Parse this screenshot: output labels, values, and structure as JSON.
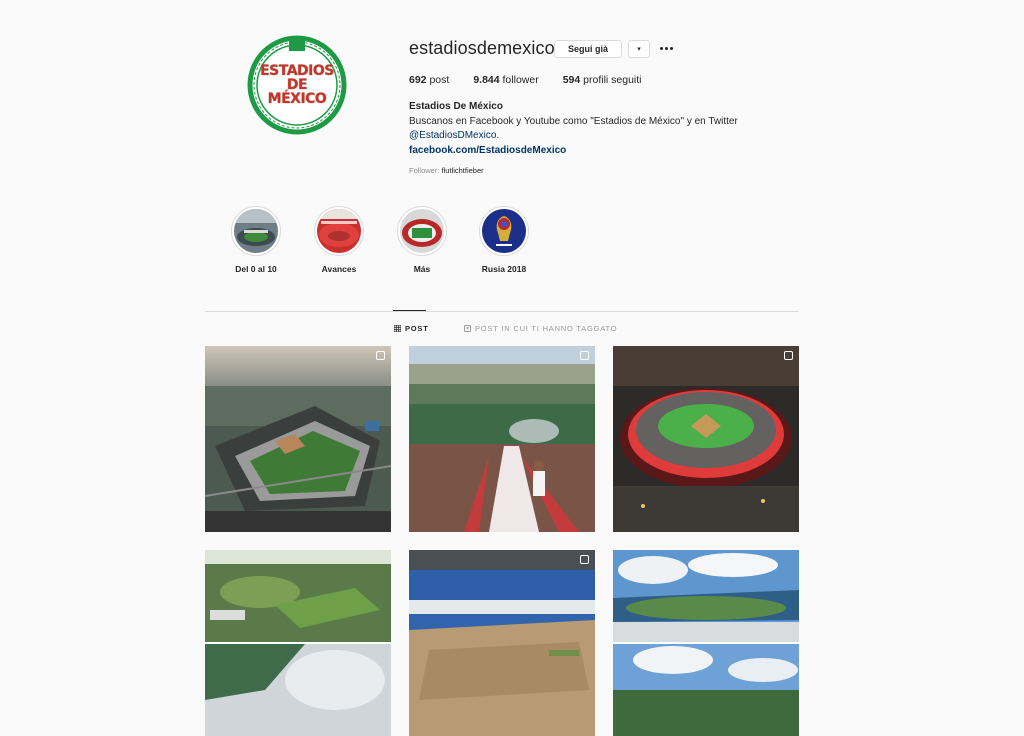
{
  "profile": {
    "username": "estadiosdemexico",
    "follow_label": "Segui già",
    "dropdown_icon": "▾",
    "more_icon": "ellipsis-icon",
    "avatar_text": [
      "ESTADIOS",
      "DE",
      "MÉXICO"
    ],
    "stats": {
      "posts_count": "692",
      "posts_label": "post",
      "followers_count": "9.844",
      "followers_label": "follower",
      "following_count": "594",
      "following_label": "profili seguiti"
    },
    "bio": {
      "name": "Estadios De México",
      "line1": "Buscanos en Facebook y Youtube como \"Estadios de México\" y en Twitter",
      "mention": "@EstadiosDMexico.",
      "link": "facebook.com/EstadiosdeMexico"
    },
    "followed_by_label": "Follower:",
    "followed_by_user": "flutlichtfieber"
  },
  "highlights": [
    {
      "label": "Del 0 al 10"
    },
    {
      "label": "Avances"
    },
    {
      "label": "Más"
    },
    {
      "label": "Rusia 2018"
    }
  ],
  "tabs": [
    {
      "label": "POST",
      "icon": "grid-icon",
      "active": true
    },
    {
      "label": "POST IN CUI TI HANNO TAGGATO",
      "icon": "tag-icon",
      "active": false
    }
  ],
  "posts": [
    {
      "name": "baseball-stadium-aerial",
      "multi": true
    },
    {
      "name": "crowd-torch-run",
      "multi": true
    },
    {
      "name": "stadium-night-aerial",
      "multi": true
    },
    {
      "name": "sports-complex-collage",
      "multi": false
    },
    {
      "name": "stadium-under-construction",
      "multi": true
    },
    {
      "name": "stadium-sky-collage",
      "multi": false
    }
  ],
  "colors": {
    "accent_link": "#003569",
    "border": "#dbdbdb",
    "logo_green": "#1e9a45",
    "logo_red": "#d32d2d"
  }
}
